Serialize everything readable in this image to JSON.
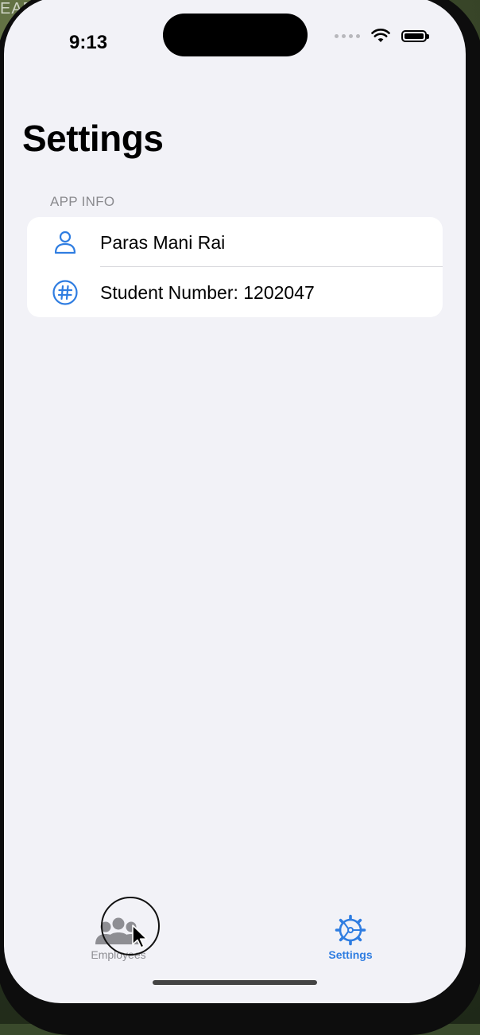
{
  "background": {
    "corner_text": "EAD"
  },
  "status_bar": {
    "time": "9:13"
  },
  "nav": {
    "title": "Settings"
  },
  "section": {
    "header": "APP INFO",
    "rows": [
      {
        "icon": "person-icon",
        "label": "Paras Mani Rai"
      },
      {
        "icon": "number-sign-icon",
        "label": "Student Number: 1202047"
      }
    ]
  },
  "tab_bar": {
    "tabs": [
      {
        "label": "Employees",
        "icon": "people-icon",
        "selected": false
      },
      {
        "label": "Settings",
        "icon": "gear-icon",
        "selected": true
      }
    ]
  },
  "colors": {
    "accent": "#2f7de1",
    "inactive": "#8e8e93",
    "background": "#f2f2f7"
  }
}
